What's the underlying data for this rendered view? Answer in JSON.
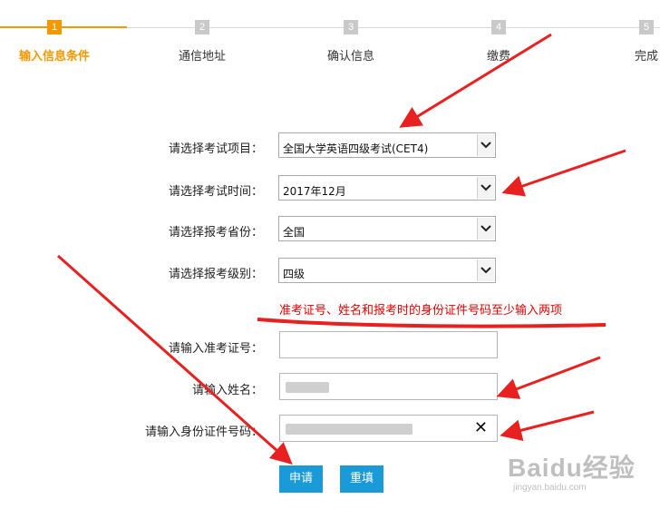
{
  "steps": [
    {
      "num": "1",
      "label": "输入信息条件"
    },
    {
      "num": "2",
      "label": "通信地址"
    },
    {
      "num": "3",
      "label": "确认信息"
    },
    {
      "num": "4",
      "label": "缴费"
    },
    {
      "num": "5",
      "label": "完成"
    }
  ],
  "form": {
    "exam_item": {
      "label": "请选择考试项目：",
      "value": "全国大学英语四级考试(CET4)"
    },
    "exam_time": {
      "label": "请选择考试时间：",
      "value": "2017年12月"
    },
    "province": {
      "label": "请选择报考省份：",
      "value": "全国"
    },
    "level": {
      "label": "请选择报考级别：",
      "value": "四级"
    },
    "note": "准考证号、姓名和报考时的身份证件号码至少输入两项",
    "ticket_no": {
      "label": "请输入准考证号："
    },
    "name": {
      "label": "请输入姓名："
    },
    "id_no": {
      "label": "请输入身份证件号码：",
      "clear_icon": "close-icon"
    }
  },
  "buttons": {
    "apply": "申请",
    "reset": "重填"
  },
  "watermark": {
    "logo": "Baidu经验",
    "site": "jingyan.baidu.com"
  },
  "colors": {
    "active_step": "#f39800",
    "button": "#1a9bd7",
    "note": "#e00000",
    "arrow": "#e82020"
  }
}
